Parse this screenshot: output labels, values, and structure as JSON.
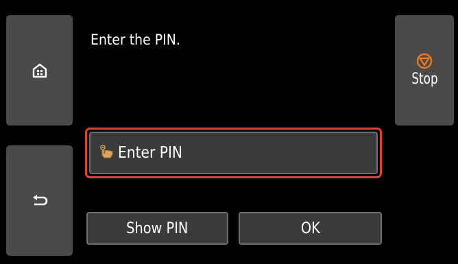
{
  "screen": {
    "message": "Enter the PIN."
  },
  "nav": {
    "home_icon": "home-icon",
    "back_icon": "back-arrow-icon"
  },
  "stop": {
    "label": "Stop",
    "icon": "stop-icon",
    "icon_color": "#f07a1a"
  },
  "pin_field": {
    "label": "Enter PIN",
    "icon": "touch-finger-icon",
    "highlight_color": "#d9443a"
  },
  "buttons": {
    "show_pin": "Show PIN",
    "ok": "OK"
  }
}
